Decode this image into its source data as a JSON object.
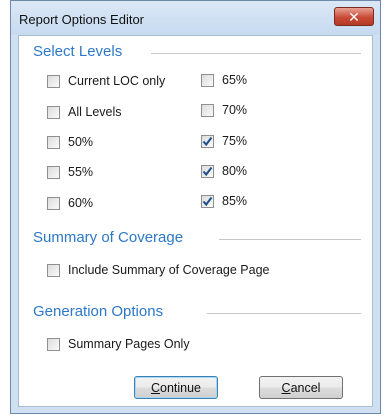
{
  "window": {
    "title": "Report Options Editor",
    "close_glyph": "✕"
  },
  "sections": {
    "select_levels": "Select Levels",
    "summary_of_coverage": "Summary of Coverage",
    "generation_options": "Generation Options"
  },
  "levels_left": [
    {
      "label": "Current LOC only",
      "checked": false
    },
    {
      "label": "All Levels",
      "checked": false
    },
    {
      "label": "50%",
      "checked": false
    },
    {
      "label": "55%",
      "checked": false
    },
    {
      "label": "60%",
      "checked": false
    }
  ],
  "levels_right": [
    {
      "label": "65%",
      "checked": false
    },
    {
      "label": "70%",
      "checked": false
    },
    {
      "label": "75%",
      "checked": true
    },
    {
      "label": "80%",
      "checked": true
    },
    {
      "label": "85%",
      "checked": true
    }
  ],
  "summary": {
    "label": "Include Summary of Coverage Page",
    "checked": false
  },
  "generation": {
    "label": "Summary Pages Only",
    "checked": false
  },
  "buttons": {
    "continue_mnemonic": "C",
    "continue_rest": "ontinue",
    "cancel_mnemonic": "C",
    "cancel_rest": "ancel"
  },
  "colors": {
    "section_title": "#2d78c8",
    "window_frame": "#cfe0f2",
    "close_button": "#c84a36",
    "check_mark": "#1e4f8a"
  }
}
